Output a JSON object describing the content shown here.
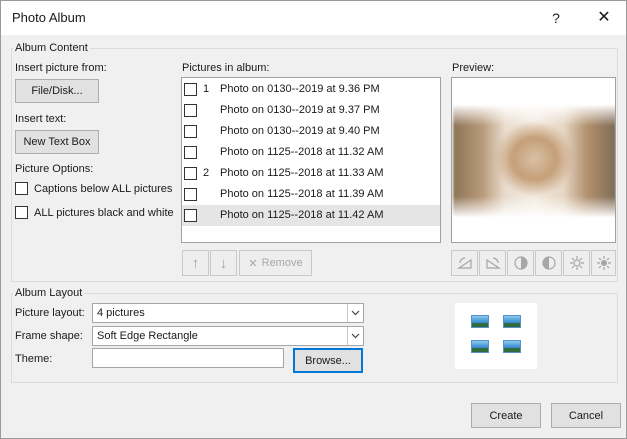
{
  "window": {
    "title": "Photo Album",
    "help_glyph": "?",
    "close_glyph": "✕"
  },
  "album_content": {
    "legend": "Album Content",
    "insert_picture_label": "Insert picture from:",
    "file_disk_button": "File/Disk...",
    "insert_text_label": "Insert text:",
    "new_text_box_button": "New Text Box",
    "picture_options_label": "Picture Options:",
    "captions_option": "Captions below ALL pictures",
    "black_white_option": "ALL pictures black and white",
    "pictures_label": "Pictures in album:",
    "pictures": [
      {
        "num": "1",
        "name": "Photo on 0130--2019 at 9.36 PM",
        "selected": false
      },
      {
        "num": "",
        "name": "Photo on 0130--2019 at 9.37 PM",
        "selected": false
      },
      {
        "num": "",
        "name": "Photo on 0130--2019 at 9.40 PM",
        "selected": false
      },
      {
        "num": "",
        "name": "Photo on 1125--2018 at 11.32 AM",
        "selected": false
      },
      {
        "num": "2",
        "name": "Photo on 1125--2018 at 11.33 AM",
        "selected": false
      },
      {
        "num": "",
        "name": "Photo on 1125--2018 at 11.39 AM",
        "selected": false
      },
      {
        "num": "",
        "name": "Photo on 1125--2018 at 11.42 AM",
        "selected": true
      }
    ],
    "move_up_glyph": "↑",
    "move_down_glyph": "↓",
    "remove_button": "Remove",
    "remove_glyph": "✕",
    "preview_label": "Preview:"
  },
  "album_layout": {
    "legend": "Album Layout",
    "picture_layout_label": "Picture layout:",
    "picture_layout_value": "4 pictures",
    "frame_shape_label": "Frame shape:",
    "frame_shape_value": "Soft Edge Rectangle",
    "theme_label": "Theme:",
    "theme_value": "",
    "browse_button": "Browse..."
  },
  "footer": {
    "create_button": "Create",
    "cancel_button": "Cancel"
  },
  "colors": {
    "accent": "#0078d7",
    "selected_row": "#e5e5e5",
    "disabled": "#a6a6a6"
  }
}
